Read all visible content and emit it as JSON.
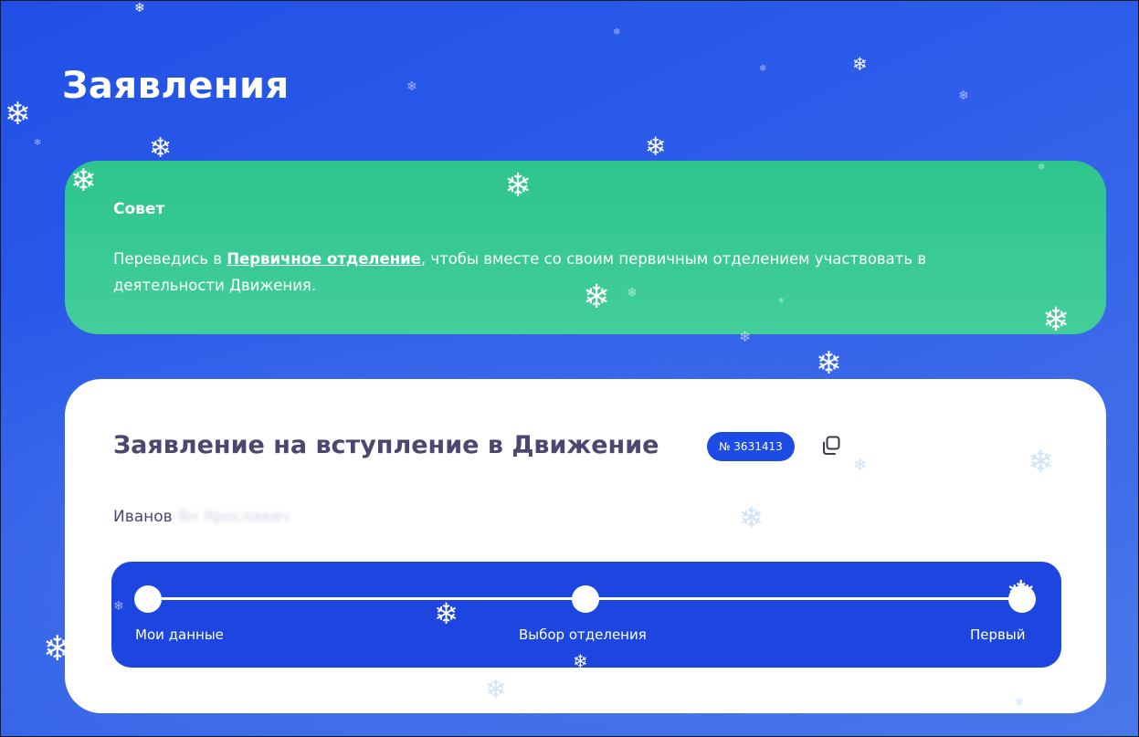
{
  "page": {
    "title": "Заявления"
  },
  "advice": {
    "title": "Совет",
    "text_before": "Переведись в ",
    "link": "Первичное отделение",
    "text_after": ", чтобы вместе со своим первичным отделением участвовать в деятельности Движения."
  },
  "application": {
    "title": "Заявление на вступление в Движение",
    "number_badge": "№ 3631413",
    "copy_icon": "copy-icon",
    "person_surname": "Иванов",
    "person_rest_blurred": "Ян Ярославич",
    "steps": [
      {
        "label": "Мои данные"
      },
      {
        "label": "Выбор отделения"
      },
      {
        "label": "Первый"
      }
    ]
  },
  "colors": {
    "background_blue": "#2250e6",
    "advice_green": "#2ec58d",
    "stepper_blue": "#1d45e0",
    "badge_blue": "#1c4be5",
    "title_text": "#4a4770"
  },
  "decoration": {
    "snowflake_glyph": "❄"
  }
}
